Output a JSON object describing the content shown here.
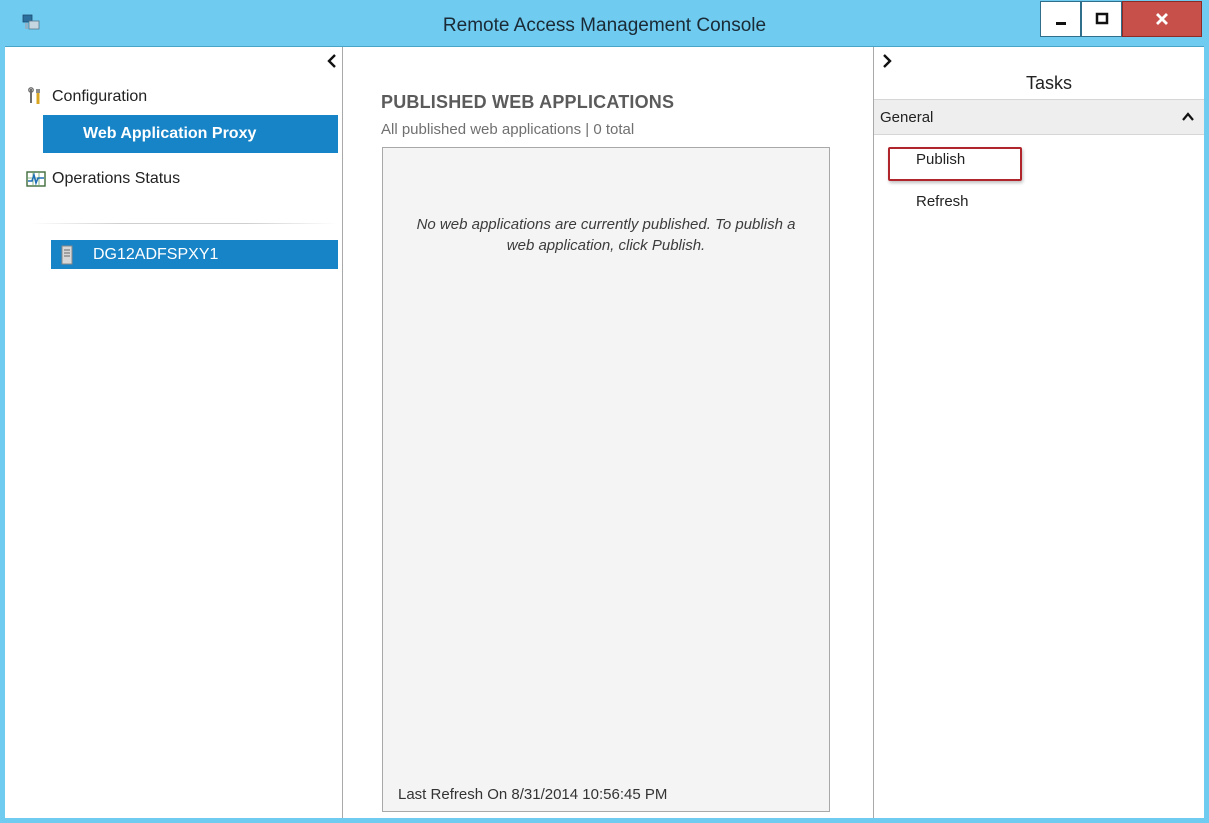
{
  "window": {
    "title": "Remote Access Management Console",
    "controls": {
      "minimize": "minimize",
      "maximize": "maximize",
      "close": "close"
    }
  },
  "colors": {
    "titlebar": "#6fcbef",
    "selection": "#1784c7",
    "close_button": "#c7504b",
    "highlight_border": "#b0242b"
  },
  "left_pane": {
    "items": {
      "configuration": {
        "label": "Configuration",
        "icon": "tools-icon"
      },
      "web_application_proxy": {
        "label": "Web Application Proxy"
      },
      "operations_status": {
        "label": "Operations Status",
        "icon": "monitor-icon"
      }
    },
    "server": {
      "label": "DG12ADFSPXY1",
      "icon": "server-icon"
    }
  },
  "center_pane": {
    "heading": "PUBLISHED WEB APPLICATIONS",
    "subheading": "All published web applications | 0 total",
    "empty_message": "No web applications are currently published. To publish a web application, click Publish.",
    "last_refresh": "Last Refresh On 8/31/2014 10:56:45 PM"
  },
  "tasks_pane": {
    "title": "Tasks",
    "section": "General",
    "tasks": {
      "publish": "Publish",
      "refresh": "Refresh"
    }
  }
}
